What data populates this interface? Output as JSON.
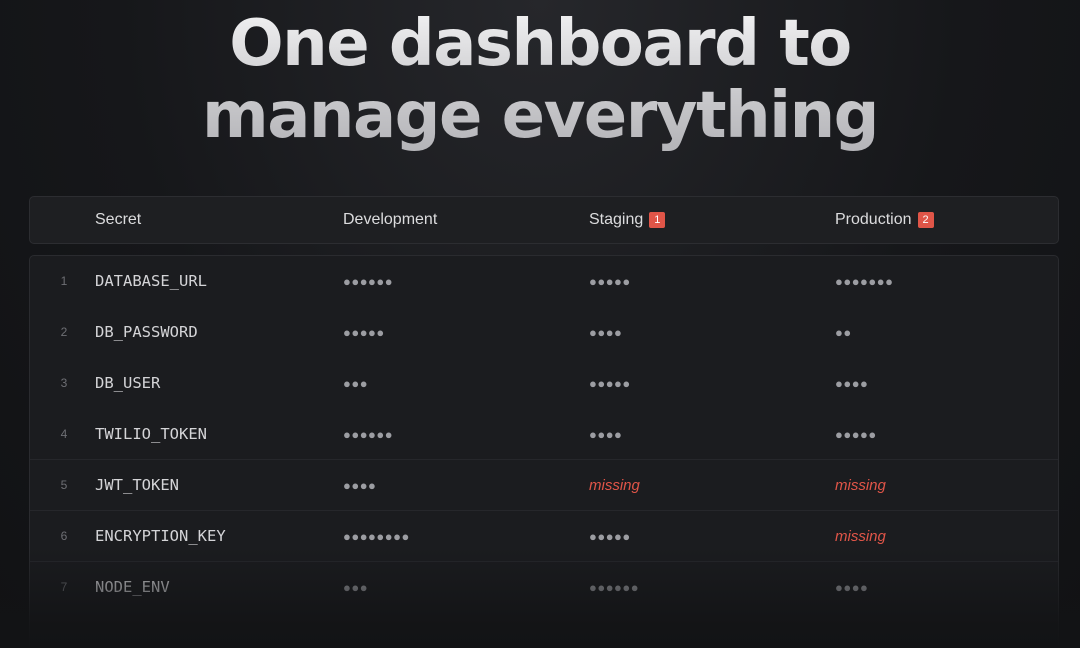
{
  "headline": {
    "line1": "One dashboard to",
    "line2": "manage everything"
  },
  "table": {
    "columns": {
      "secret": "Secret",
      "development": "Development",
      "staging": "Staging",
      "staging_badge": "1",
      "production": "Production",
      "production_badge": "2"
    },
    "rows": [
      {
        "index": "1",
        "key": "DATABASE_URL",
        "development": "●●●●●●",
        "staging": "●●●●●",
        "production": "●●●●●●●"
      },
      {
        "index": "2",
        "key": "DB_PASSWORD",
        "development": "●●●●●",
        "staging": "●●●●",
        "production": "●●"
      },
      {
        "index": "3",
        "key": "DB_USER",
        "development": "●●●",
        "staging": "●●●●●",
        "production": "●●●●"
      },
      {
        "index": "4",
        "key": "TWILIO_TOKEN",
        "development": "●●●●●●",
        "staging": "●●●●",
        "production": "●●●●●"
      },
      {
        "index": "5",
        "key": "JWT_TOKEN",
        "development": "●●●●",
        "staging": "missing",
        "production": "missing"
      },
      {
        "index": "6",
        "key": "ENCRYPTION_KEY",
        "development": "●●●●●●●●",
        "staging": "●●●●●",
        "production": "missing"
      },
      {
        "index": "7",
        "key": "NODE_ENV",
        "development": "●●●",
        "staging": "●●●●●●",
        "production": "●●●●"
      }
    ]
  }
}
